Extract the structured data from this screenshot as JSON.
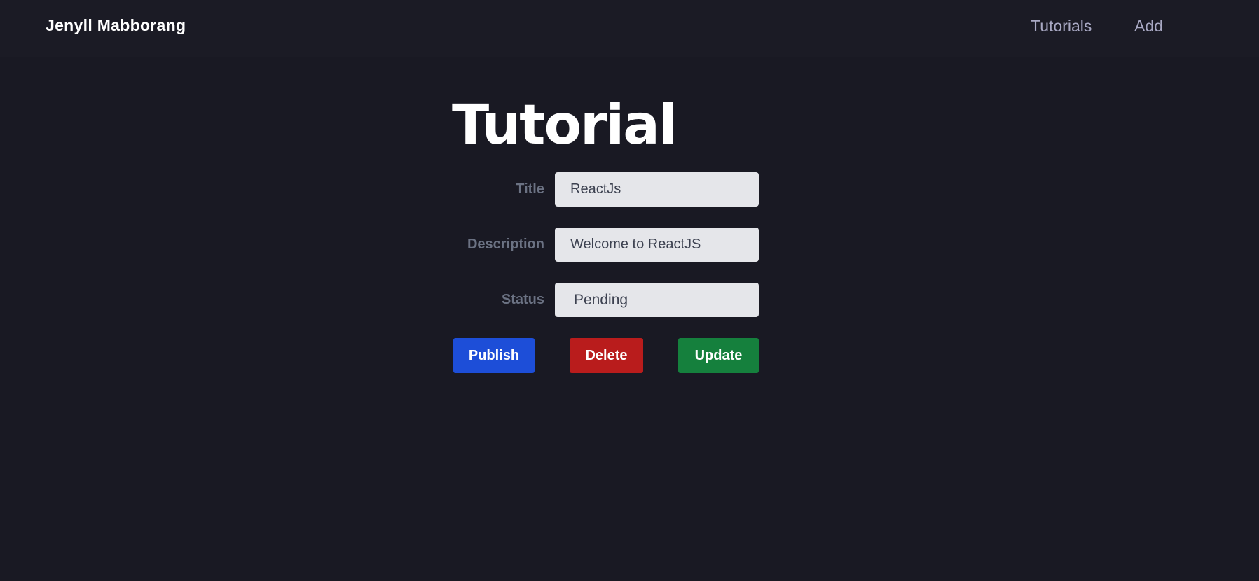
{
  "navbar": {
    "brand": "Jenyll Mabborang",
    "links": [
      {
        "label": "Tutorials"
      },
      {
        "label": "Add"
      }
    ]
  },
  "page": {
    "title": "Tutorial"
  },
  "form": {
    "title": {
      "label": "Title",
      "value": "ReactJs"
    },
    "description": {
      "label": "Description",
      "value": "Welcome to ReactJS"
    },
    "status": {
      "label": "Status",
      "value": "Pending"
    }
  },
  "actions": {
    "publish_label": "Publish",
    "delete_label": "Delete",
    "update_label": "Update"
  },
  "colors": {
    "background": "#191923",
    "publish": "#1d4ed8",
    "delete": "#b91c1c",
    "update": "#15803d"
  }
}
